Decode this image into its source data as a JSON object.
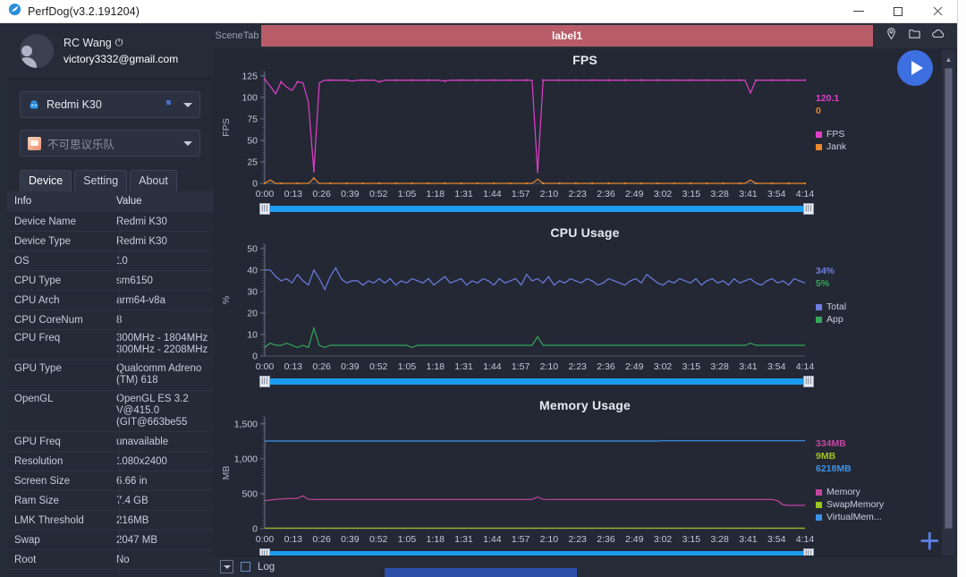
{
  "window": {
    "title": "PerfDog(v3.2.191204)",
    "app_icon": "perfdog-logo-icon",
    "minimize": "minimize",
    "maximize": "maximize",
    "close": "close"
  },
  "sidebar": {
    "user": {
      "name": "RC Wang",
      "power_icon": "power-icon",
      "email": "victory3332@gmail.com"
    },
    "device_select": {
      "label": "Redmi K30",
      "icon": "android-icon",
      "link_icon": "link-icon",
      "caret": "chevron-down-icon"
    },
    "app_select": {
      "label": "不可思议乐队",
      "icon": "app-icon",
      "caret": "chevron-down-icon"
    },
    "tabs": [
      {
        "label": "Device",
        "active": true
      },
      {
        "label": "Setting",
        "active": false
      },
      {
        "label": "About",
        "active": false
      }
    ],
    "table": {
      "headers": [
        "Info",
        "Value"
      ],
      "rows": [
        {
          "info": "Device Name",
          "value": "Redmi K30"
        },
        {
          "info": "Device Type",
          "value": "Redmi K30"
        },
        {
          "info": "OS",
          "value": "10"
        },
        {
          "info": "CPU Type",
          "value": "sm6150"
        },
        {
          "info": "CPU Arch",
          "value": "arm64-v8a"
        },
        {
          "info": "CPU CoreNum",
          "value": "8"
        },
        {
          "info": "CPU Freq",
          "value": "300MHz - 1804MHz\n300MHz - 2208MHz"
        },
        {
          "info": "GPU Type",
          "value": "Qualcomm Adreno\n(TM) 618"
        },
        {
          "info": "OpenGL",
          "value": "OpenGL ES 3.2\nV@415.0\n(GIT@663be55"
        },
        {
          "info": "GPU Freq",
          "value": "unavailable"
        },
        {
          "info": "Resolution",
          "value": "1080x2400"
        },
        {
          "info": "Screen Size",
          "value": "6.66 in"
        },
        {
          "info": "Ram Size",
          "value": "7.4 GB"
        },
        {
          "info": "LMK Threshold",
          "value": "216MB"
        },
        {
          "info": "Swap",
          "value": "2047 MB"
        },
        {
          "info": "Root",
          "value": "No"
        }
      ]
    }
  },
  "scenebar": {
    "tab_label": "SceneTab",
    "label_bar": "label1",
    "icons": [
      "location-pin-icon",
      "folder-icon",
      "cloud-icon"
    ]
  },
  "controls": {
    "play_button": "play-icon",
    "add_button": "plus-icon"
  },
  "bottom": {
    "collapse_button": "chevron-down-icon",
    "log_checkbox_label": "Log"
  },
  "chart_data": [
    {
      "type": "line",
      "title": "FPS",
      "ylabel": "FPS",
      "xlabel": "",
      "ylim": [
        0,
        130
      ],
      "yticks": [
        0,
        25,
        50,
        75,
        100,
        125
      ],
      "xticks": [
        "0:00",
        "0:13",
        "0:26",
        "0:39",
        "0:52",
        "1:05",
        "1:18",
        "1:31",
        "1:44",
        "1:57",
        "2:10",
        "2:23",
        "2:36",
        "2:49",
        "3:02",
        "3:15",
        "3:28",
        "3:41",
        "3:54",
        "4:14"
      ],
      "grid": false,
      "legend_position": "right",
      "current_values": [
        {
          "name": "FPS",
          "value": "120.1",
          "color": "#e040c8"
        },
        {
          "name": "Jank",
          "value": "0",
          "color": "#e8882a"
        }
      ],
      "series": [
        {
          "name": "FPS",
          "color": "#e040c8",
          "values": [
            121,
            113,
            104,
            118,
            112,
            108,
            118,
            117,
            94,
            14,
            117,
            120,
            120,
            120,
            120,
            120,
            119,
            120,
            120,
            120,
            120,
            118,
            120,
            120,
            120,
            120,
            120,
            120,
            120,
            120,
            120,
            120,
            120,
            119,
            120,
            120,
            120,
            120,
            120,
            120,
            120,
            120,
            120,
            120,
            120,
            120,
            120,
            120,
            120,
            120,
            12,
            120,
            120,
            120,
            120,
            120,
            120,
            120,
            120,
            120,
            120,
            120,
            120,
            120,
            120,
            120,
            120,
            120,
            120,
            120,
            120,
            120,
            120,
            120,
            120,
            120,
            120,
            120,
            120,
            120,
            120,
            120,
            120,
            120,
            120,
            120,
            120,
            120,
            120,
            105,
            120,
            120,
            120,
            120,
            120,
            120,
            120,
            120,
            120,
            120
          ]
        },
        {
          "name": "Jank",
          "color": "#e8882a",
          "values": [
            0,
            4,
            0,
            0,
            0,
            0,
            0,
            0,
            0,
            6,
            0,
            0,
            0,
            0,
            0,
            0,
            0,
            0,
            0,
            0,
            0,
            0,
            0,
            0,
            0,
            0,
            0,
            0,
            0,
            0,
            0,
            0,
            0,
            0,
            0,
            0,
            0,
            0,
            0,
            0,
            0,
            0,
            0,
            0,
            0,
            0,
            0,
            0,
            0,
            0,
            5,
            0,
            0,
            0,
            0,
            0,
            0,
            0,
            0,
            0,
            0,
            0,
            0,
            0,
            0,
            0,
            0,
            0,
            0,
            0,
            0,
            0,
            0,
            0,
            0,
            0,
            0,
            0,
            0,
            0,
            0,
            0,
            0,
            0,
            0,
            0,
            0,
            0,
            0,
            4,
            0,
            0,
            0,
            0,
            0,
            0,
            0,
            0,
            0,
            0
          ]
        }
      ]
    },
    {
      "type": "line",
      "title": "CPU Usage",
      "ylabel": "%",
      "xlabel": "",
      "ylim": [
        0,
        52
      ],
      "yticks": [
        0,
        10,
        20,
        30,
        40,
        50
      ],
      "xticks": [
        "0:00",
        "0:13",
        "0:26",
        "0:39",
        "0:52",
        "1:05",
        "1:18",
        "1:31",
        "1:44",
        "1:57",
        "2:10",
        "2:23",
        "2:36",
        "2:49",
        "3:02",
        "3:15",
        "3:28",
        "3:41",
        "3:54",
        "4:14"
      ],
      "grid": false,
      "legend_position": "right",
      "current_values": [
        {
          "name": "Total",
          "value": "34%",
          "color": "#6d7ee0"
        },
        {
          "name": "App",
          "value": "5%",
          "color": "#35a85a"
        }
      ],
      "series": [
        {
          "name": "Total",
          "color": "#6d7ee0",
          "values": [
            40,
            40,
            37,
            35,
            36,
            34,
            38,
            35,
            33,
            40,
            36,
            31,
            37,
            41,
            36,
            34,
            35,
            35,
            33,
            35,
            34,
            36,
            34,
            36,
            33,
            35,
            34,
            36,
            35,
            34,
            36,
            33,
            35,
            37,
            34,
            35,
            36,
            33,
            35,
            34,
            36,
            35,
            33,
            36,
            34,
            35,
            36,
            33,
            38,
            35,
            36,
            34,
            37,
            33,
            35,
            34,
            36,
            35,
            34,
            36,
            35,
            33,
            34,
            36,
            35,
            34,
            33,
            35,
            36,
            34,
            38,
            36,
            34,
            33,
            35,
            34,
            36,
            35,
            34,
            36,
            33,
            35,
            36,
            34,
            35,
            33,
            36,
            34,
            35,
            36,
            34,
            33,
            35,
            36,
            34,
            35,
            33,
            36,
            35,
            34
          ]
        },
        {
          "name": "App",
          "color": "#35a85a",
          "values": [
            4,
            6,
            5,
            5,
            6,
            5,
            4,
            5,
            4,
            13,
            5,
            4,
            5,
            5,
            5,
            5,
            5,
            5,
            5,
            5,
            5,
            5,
            5,
            5,
            5,
            5,
            5,
            4,
            5,
            5,
            5,
            5,
            5,
            5,
            5,
            5,
            5,
            5,
            5,
            5,
            5,
            5,
            5,
            5,
            5,
            5,
            5,
            5,
            5,
            5,
            9,
            5,
            5,
            5,
            5,
            5,
            5,
            5,
            5,
            5,
            5,
            5,
            5,
            5,
            5,
            5,
            5,
            5,
            5,
            5,
            5,
            5,
            5,
            5,
            5,
            5,
            5,
            5,
            5,
            5,
            5,
            5,
            5,
            5,
            5,
            5,
            5,
            5,
            5,
            6,
            5,
            5,
            5,
            5,
            5,
            5,
            5,
            5,
            5,
            5
          ]
        }
      ]
    },
    {
      "type": "line",
      "title": "Memory Usage",
      "ylabel": "MB",
      "xlabel": "",
      "ylim": [
        0,
        1600
      ],
      "yticks": [
        0,
        500,
        1000,
        1500
      ],
      "ytick_labels": [
        "0",
        "500",
        "1,000",
        "1,500"
      ],
      "xticks": [
        "0:00",
        "0:13",
        "0:26",
        "0:39",
        "0:52",
        "1:05",
        "1:18",
        "1:31",
        "1:44",
        "1:57",
        "2:10",
        "2:23",
        "2:36",
        "2:49",
        "3:02",
        "3:15",
        "3:28",
        "3:41",
        "3:54",
        "4:14"
      ],
      "grid": false,
      "legend_position": "right",
      "current_values": [
        {
          "name": "Memory",
          "value": "334MB",
          "color": "#c246a0"
        },
        {
          "name": "SwapMemory",
          "value": "9MB",
          "color": "#9cc420"
        },
        {
          "name": "VirtualMem...",
          "value": "6218MB",
          "color": "#3d93e8"
        }
      ],
      "series": [
        {
          "name": "Memory",
          "color": "#c246a0",
          "values": [
            400,
            410,
            420,
            425,
            430,
            432,
            435,
            470,
            420,
            418,
            418,
            418,
            418,
            418,
            418,
            418,
            418,
            418,
            418,
            418,
            418,
            418,
            418,
            418,
            418,
            418,
            418,
            418,
            418,
            418,
            418,
            418,
            418,
            418,
            418,
            418,
            418,
            418,
            418,
            418,
            418,
            418,
            418,
            418,
            418,
            418,
            418,
            418,
            418,
            418,
            455,
            420,
            418,
            418,
            418,
            418,
            418,
            418,
            418,
            418,
            418,
            418,
            418,
            418,
            418,
            418,
            418,
            418,
            418,
            418,
            418,
            418,
            418,
            418,
            418,
            418,
            418,
            418,
            418,
            418,
            418,
            418,
            418,
            418,
            418,
            418,
            418,
            418,
            418,
            418,
            418,
            418,
            418,
            418,
            400,
            340,
            334,
            334,
            334,
            334
          ]
        },
        {
          "name": "SwapMemory",
          "color": "#9cc420",
          "values": [
            9,
            9,
            9,
            9,
            9,
            9,
            9,
            9,
            9,
            9,
            9,
            9,
            9,
            9,
            9,
            9,
            9,
            9,
            9,
            9,
            9,
            9,
            9,
            9,
            9,
            9,
            9,
            9,
            9,
            9,
            9,
            9,
            9,
            9,
            9,
            9,
            9,
            9,
            9,
            9,
            9,
            9,
            9,
            9,
            9,
            9,
            9,
            9,
            9,
            9,
            9,
            9,
            9,
            9,
            9,
            9,
            9,
            9,
            9,
            9,
            9,
            9,
            9,
            9,
            9,
            9,
            9,
            9,
            9,
            9,
            9,
            9,
            9,
            9,
            9,
            9,
            9,
            9,
            9,
            9,
            9,
            9,
            9,
            9,
            9,
            9,
            9,
            9,
            9,
            9,
            9,
            9,
            9,
            9,
            9,
            9,
            9,
            9,
            9,
            9
          ]
        },
        {
          "name": "VirtualMem...",
          "color": "#3d93e8",
          "values": [
            1255,
            1255,
            1255,
            1255,
            1255,
            1255,
            1255,
            1255,
            1255,
            1255,
            1255,
            1255,
            1255,
            1255,
            1255,
            1255,
            1255,
            1255,
            1255,
            1255,
            1255,
            1255,
            1255,
            1255,
            1255,
            1255,
            1255,
            1255,
            1255,
            1255,
            1255,
            1255,
            1255,
            1255,
            1255,
            1255,
            1255,
            1255,
            1255,
            1255,
            1255,
            1255,
            1255,
            1255,
            1255,
            1255,
            1255,
            1255,
            1255,
            1255,
            1255,
            1255,
            1255,
            1255,
            1255,
            1255,
            1255,
            1255,
            1255,
            1255,
            1255,
            1255,
            1255,
            1255,
            1255,
            1255,
            1255,
            1255,
            1255,
            1255,
            1255,
            1255,
            1255,
            1258,
            1258,
            1258,
            1258,
            1258,
            1258,
            1258,
            1258,
            1258,
            1258,
            1258,
            1258,
            1258,
            1258,
            1258,
            1258,
            1258,
            1258,
            1258,
            1258,
            1258,
            1258,
            1258,
            1258,
            1258,
            1258,
            1258
          ]
        }
      ]
    }
  ]
}
